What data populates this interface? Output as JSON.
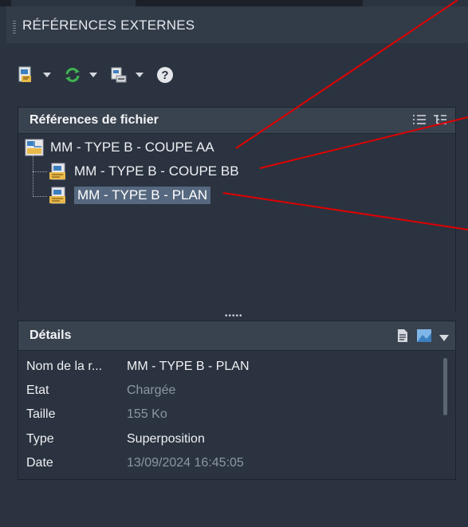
{
  "panel_title": "RÉFÉRENCES EXTERNES",
  "toolbar": {
    "attach_icon": "attach-dwg-icon",
    "refresh_icon": "refresh-icon",
    "change_path_icon": "change-path-icon",
    "help_icon": "help-icon",
    "help_glyph": "?"
  },
  "file_references": {
    "title": "Références de fichier",
    "list_view_icon": "list-view-icon",
    "tree_view_icon": "tree-view-icon",
    "items": [
      {
        "label": "MM - TYPE B - COUPE AA",
        "level": 0,
        "icon": "drawing-root-icon"
      },
      {
        "label": "MM - TYPE B - COUPE BB",
        "level": 1,
        "icon": "xref-dwg-icon"
      },
      {
        "label": "MM - TYPE B - PLAN",
        "level": 1,
        "icon": "xref-dwg-icon",
        "selected": true
      }
    ]
  },
  "splitter_dots": "•••••",
  "details": {
    "title": "Détails",
    "details_icon": "details-view-icon",
    "preview_icon": "preview-icon",
    "dropdown_icon": "chevron-down-icon",
    "rows": [
      {
        "key": "Nom de la r...",
        "value": "MM - TYPE B - PLAN",
        "muted": false
      },
      {
        "key": "Etat",
        "value": "Chargée",
        "muted": true
      },
      {
        "key": "Taille",
        "value": "155 Ko",
        "muted": true
      },
      {
        "key": "Type",
        "value": "Superposition",
        "muted": false
      },
      {
        "key": "Date",
        "value": "13/09/2024 16:45:05",
        "muted": true
      }
    ]
  },
  "colors": {
    "background": "#2b3340",
    "header": "#39424f",
    "selection": "#56687f",
    "annotation_line": "#e00000",
    "refresh_green": "#3fb34f"
  }
}
